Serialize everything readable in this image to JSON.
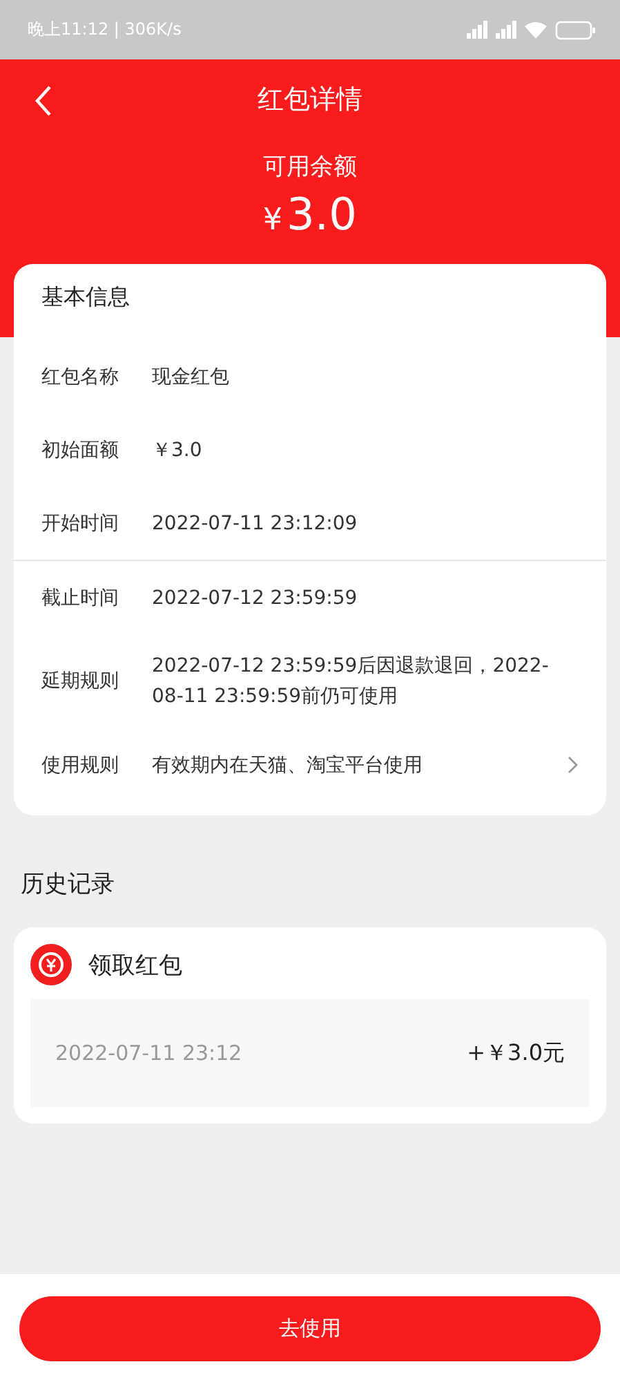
{
  "status_bar": {
    "time": "晚上11:12 | 306K/s"
  },
  "header": {
    "title": "红包详情",
    "balance_label": "可用余额",
    "currency": "¥",
    "amount": "3.0"
  },
  "basic_info": {
    "title": "基本信息",
    "rows": [
      {
        "label": "红包名称",
        "value": "现金红包",
        "divider_after": false,
        "has_arrow": false
      },
      {
        "label": "初始面额",
        "value": "￥3.0",
        "divider_after": false,
        "has_arrow": false
      },
      {
        "label": "开始时间",
        "value": "2022-07-11 23:12:09",
        "divider_after": true,
        "has_arrow": false
      },
      {
        "label": "截止时间",
        "value": "2022-07-12 23:59:59",
        "divider_after": false,
        "has_arrow": false
      },
      {
        "label": "延期规则",
        "value": "2022-07-12 23:59:59后因退款退回，2022-08-11 23:59:59前仍可使用",
        "divider_after": false,
        "has_arrow": false
      },
      {
        "label": "使用规则",
        "value": "有效期内在天猫、淘宝平台使用",
        "divider_after": false,
        "has_arrow": true
      }
    ]
  },
  "history": {
    "title": "历史记录",
    "records": [
      {
        "title": "领取红包",
        "time": "2022-07-11 23:12",
        "amount": "+￥3.0元"
      }
    ]
  },
  "use_button": "去使用"
}
